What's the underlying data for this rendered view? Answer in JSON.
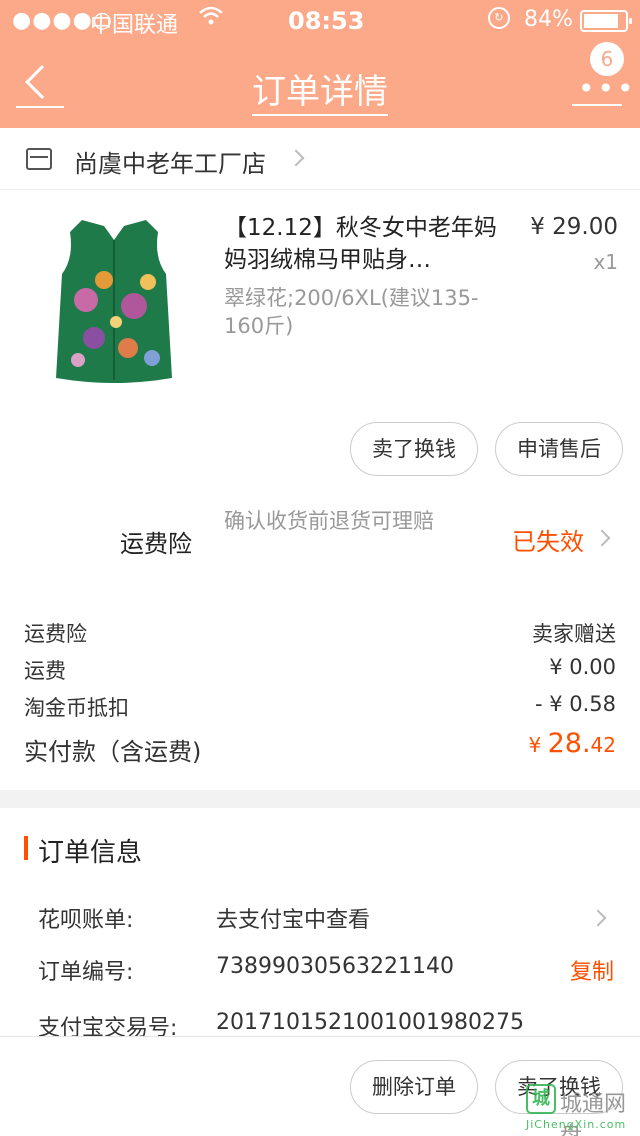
{
  "status_bar": {
    "signal": "●●●●○",
    "carrier": "中国联通",
    "time": "08:53",
    "battery": "84%",
    "battery_level": 0.84
  },
  "nav": {
    "title": "订单详情",
    "badge_count": "6"
  },
  "shop": {
    "name": "尚虞中老年工厂店"
  },
  "product": {
    "title": "【12.12】秋冬女中老年妈妈羽绒棉马甲贴身…",
    "sku": "翠绿花;200/6XL(建议135-160斤)",
    "price": "¥ 29.00",
    "qty": "x1"
  },
  "item_actions": {
    "sell_label": "卖了换钱",
    "after_sale_label": "申请售后"
  },
  "insurance": {
    "label": "运费险",
    "desc": "确认收货前退货可理赔",
    "status": "已失效"
  },
  "fees": [
    {
      "label": "运费险",
      "value": "卖家赠送"
    },
    {
      "label": "运费",
      "value": "¥ 0.00"
    },
    {
      "label": "淘金币抵扣",
      "value": "- ¥ 0.58"
    }
  ],
  "total": {
    "label": "实付款（含运费)",
    "currency": "¥ ",
    "integer": "28.",
    "decimal": "42"
  },
  "order_info": {
    "title": "订单信息",
    "rows": [
      {
        "key": "花呗账单:",
        "value": "去支付宝中查看"
      },
      {
        "key": "订单编号:",
        "value": "73899030563221140",
        "action": "复制"
      },
      {
        "key": "支付宝交易号:",
        "value": "2017101521001001980275"
      }
    ]
  },
  "bottom_actions": {
    "delete_label": "删除订单",
    "sell_label": "卖了换钱"
  },
  "watermark": {
    "mark": "城",
    "name": "城通网盘",
    "url": "JiChengXin.com"
  },
  "colors": {
    "header_bg": "#fca98a",
    "accent": "#ff5000",
    "watermark_green": "#2bb24c"
  }
}
